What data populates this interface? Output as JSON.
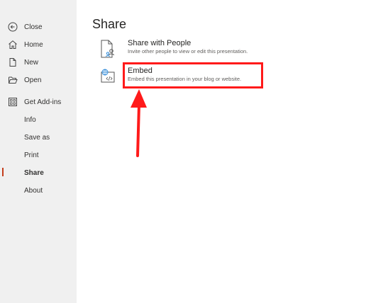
{
  "sidebar": {
    "items": [
      {
        "label": "Close",
        "icon": "back-circle-icon"
      },
      {
        "label": "Home",
        "icon": "home-icon"
      },
      {
        "label": "New",
        "icon": "new-document-icon"
      },
      {
        "label": "Open",
        "icon": "folder-open-icon"
      },
      {
        "label": "Get Add-ins",
        "icon": "add-ins-grid-icon"
      },
      {
        "label": "Info"
      },
      {
        "label": "Save as"
      },
      {
        "label": "Print"
      },
      {
        "label": "Share"
      },
      {
        "label": "About"
      }
    ],
    "active": "Share"
  },
  "main": {
    "title": "Share",
    "options": [
      {
        "title": "Share with People",
        "description": "Invite other people to view or edit this presentation.",
        "icon": "share-people-document-icon"
      },
      {
        "title": "Embed",
        "description": "Embed this presentation in your blog or website.",
        "icon": "embed-globe-icon"
      }
    ]
  },
  "annotation": {
    "color": "#ff1a1a"
  }
}
